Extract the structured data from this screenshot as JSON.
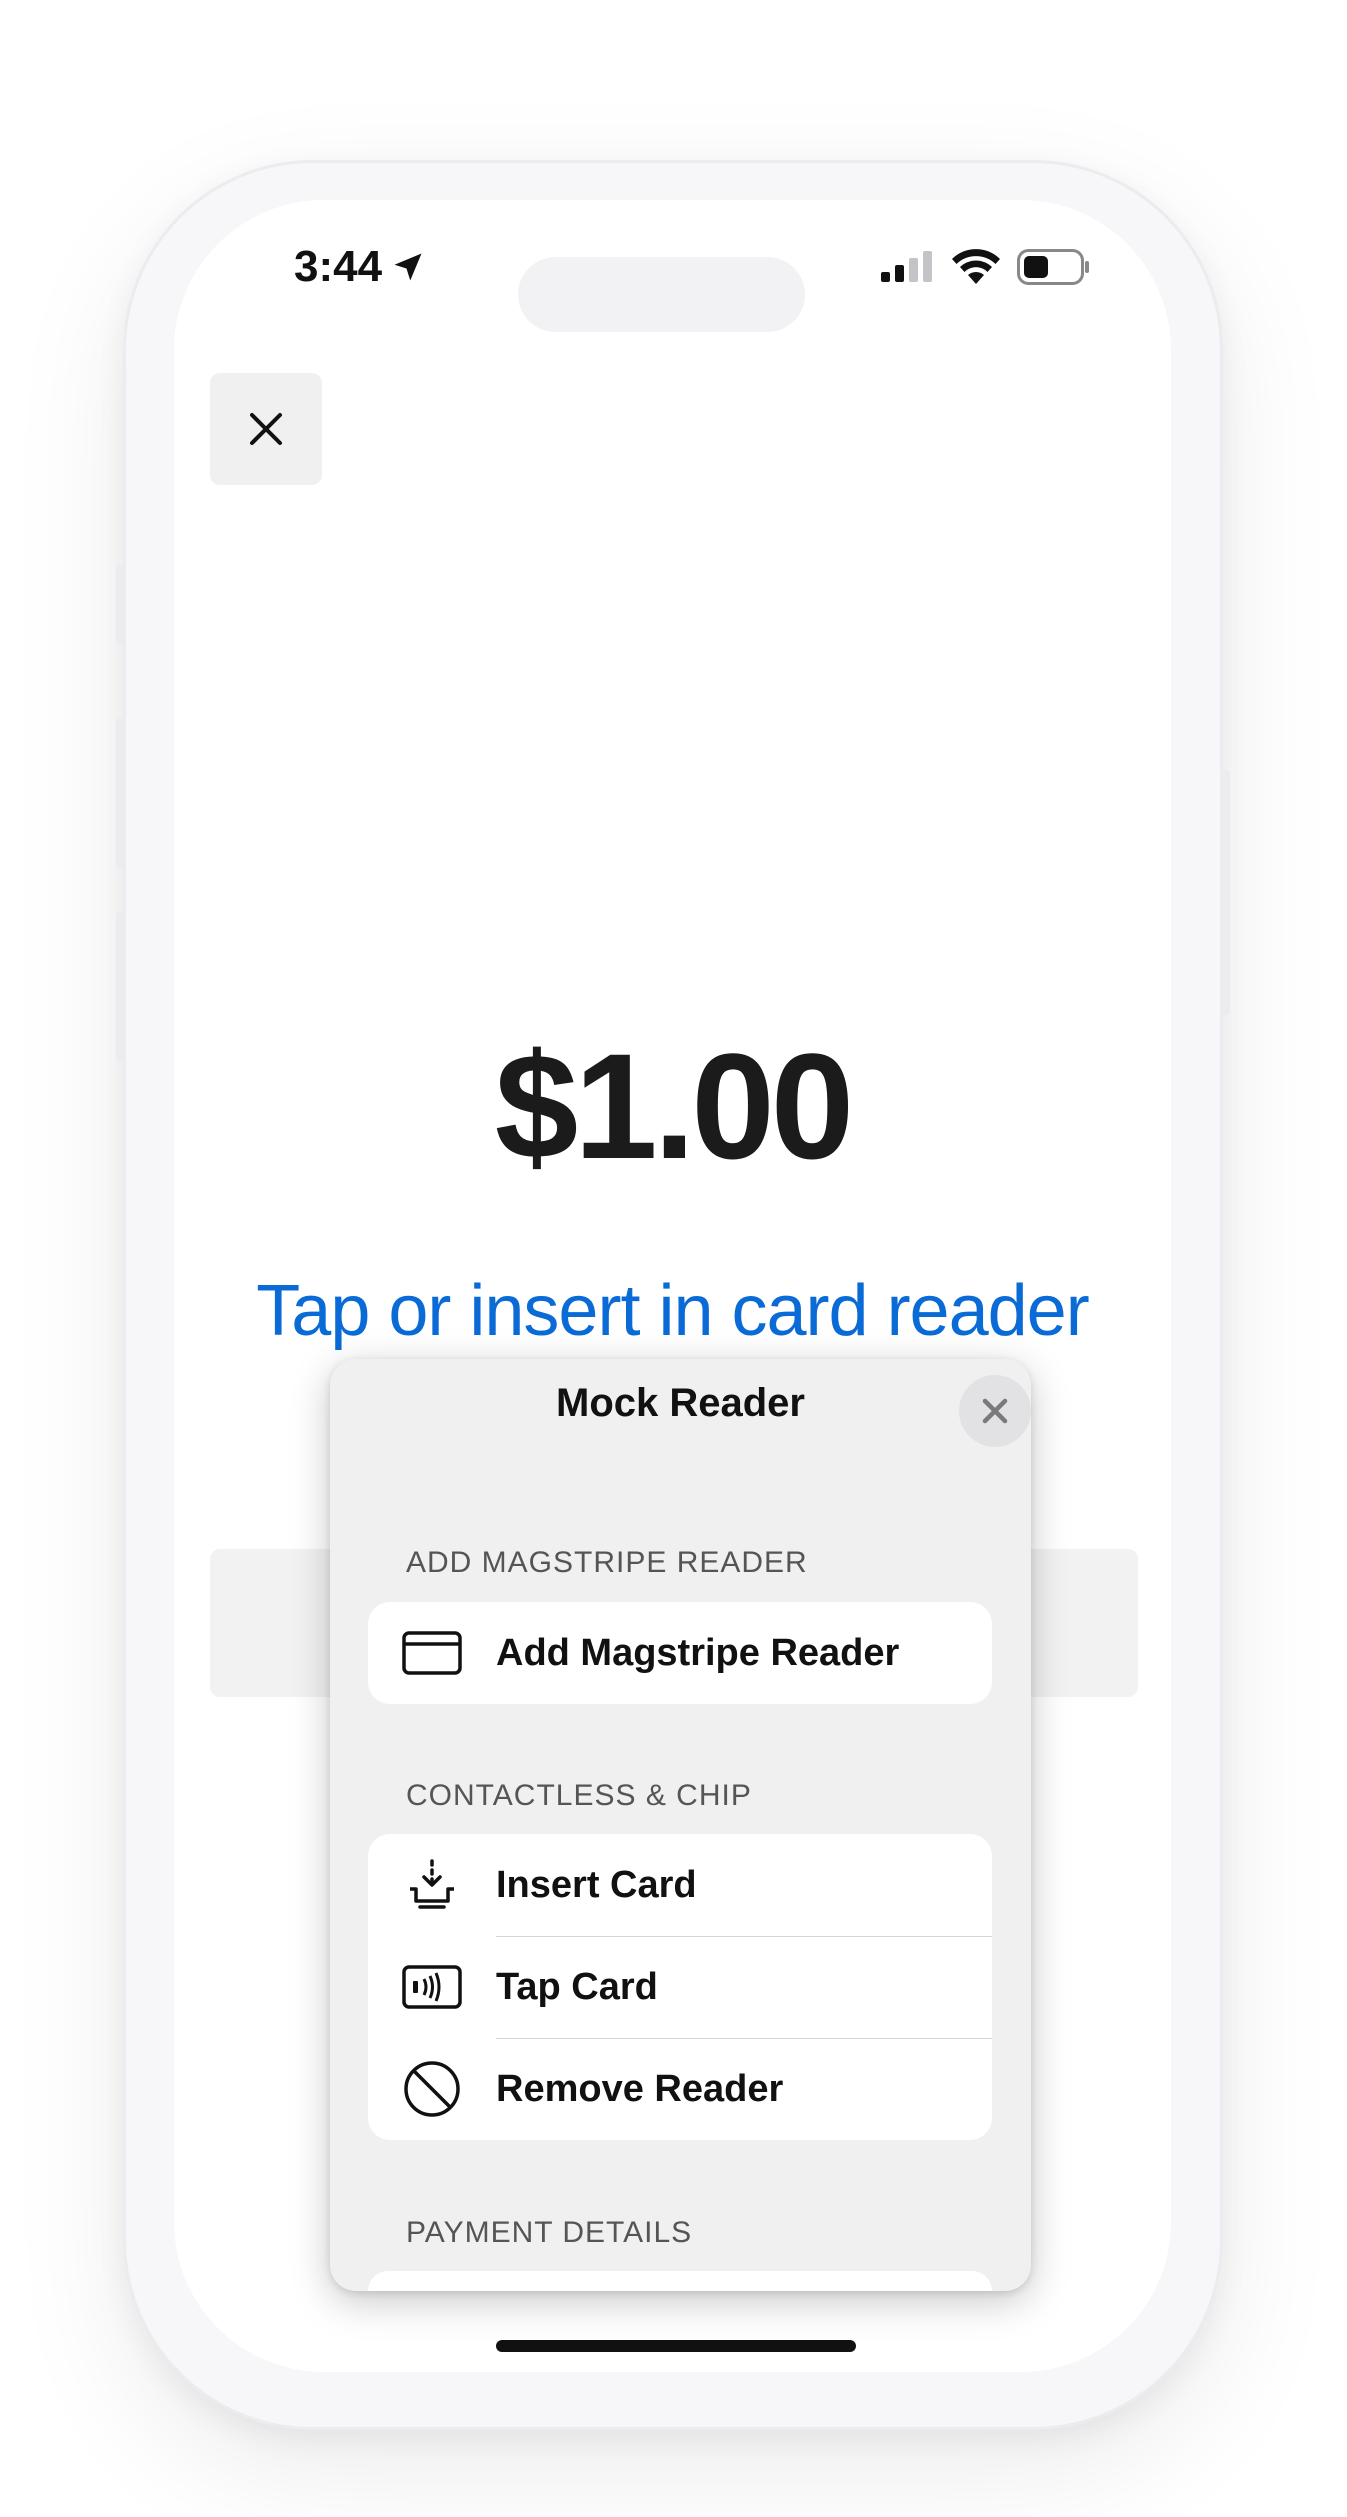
{
  "status_bar": {
    "time": "3:44"
  },
  "payment": {
    "amount": "$1.00",
    "instruction": "Tap or insert in card reader"
  },
  "mock_reader": {
    "title": "Mock Reader",
    "sections": {
      "magstripe": {
        "header": "ADD MAGSTRIPE READER",
        "items": [
          {
            "label": "Add Magstripe Reader",
            "icon": "credit-card-icon"
          }
        ]
      },
      "contactless": {
        "header": "CONTACTLESS & CHIP",
        "items": [
          {
            "label": "Insert Card",
            "icon": "insert-card-icon"
          },
          {
            "label": "Tap Card",
            "icon": "contactless-card-icon"
          },
          {
            "label": "Remove Reader",
            "icon": "prohibited-icon"
          }
        ]
      },
      "payment_details": {
        "header": "PAYMENT DETAILS"
      }
    }
  },
  "colors": {
    "accent": "#0a6bd6",
    "text": "#1b1b1b",
    "sheet_background": "#f0f0f0"
  }
}
